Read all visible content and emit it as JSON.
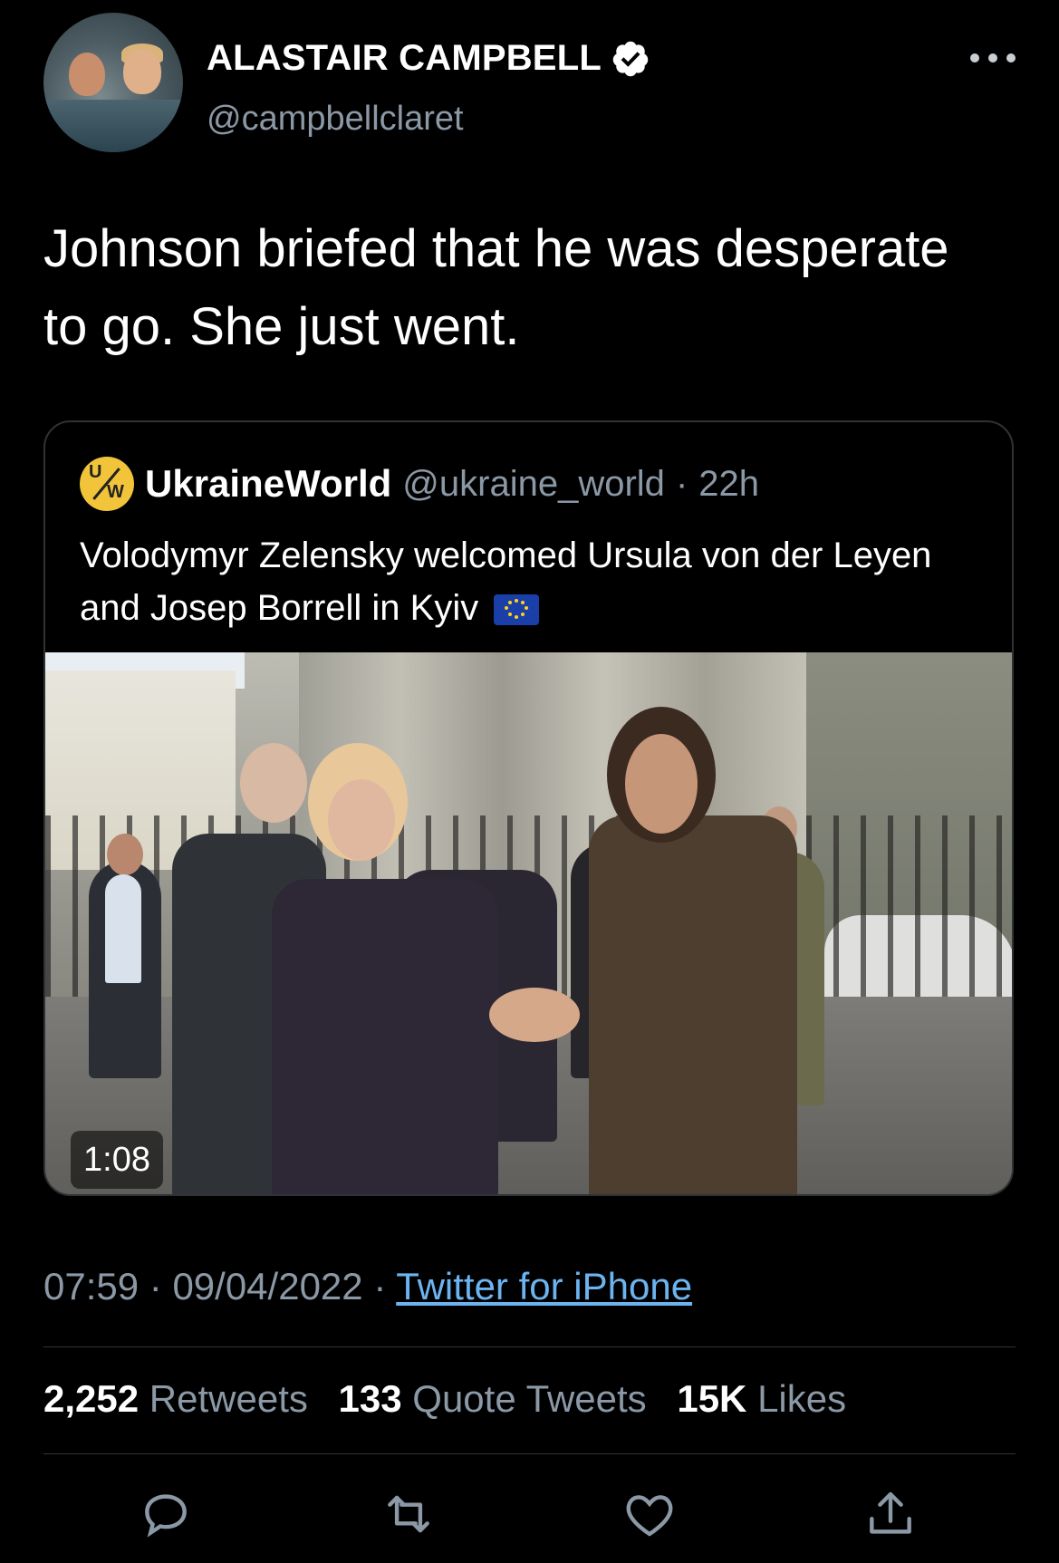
{
  "author": {
    "display_name": "ALASTAIR CAMPBELL",
    "handle": "@campbellclaret",
    "verified": true
  },
  "tweet": {
    "text": "Johnson briefed that he was desperate to go. She just went."
  },
  "quoted_tweet": {
    "author_name": "UkraineWorld",
    "handle": "@ukraine_world",
    "time_ago": "22h",
    "text": "Volodymyr Zelensky welcomed Ursula von der Leyen and Josep Borrell in Kyiv",
    "video_duration": "1:08",
    "avatar_letters": {
      "top": "U",
      "bottom": "W"
    }
  },
  "meta": {
    "time": "07:59",
    "date": "09/04/2022",
    "source": "Twitter for iPhone"
  },
  "stats": {
    "retweets_count": "2,252",
    "retweets_label": "Retweets",
    "quotes_count": "133",
    "quotes_label": "Quote Tweets",
    "likes_count": "15K",
    "likes_label": "Likes"
  },
  "actions": [
    "reply-icon",
    "retweet-icon",
    "like-icon",
    "share-icon"
  ],
  "colors": {
    "background": "#000000",
    "text": "#ffffff",
    "secondary_text": "#8b98a5",
    "link": "#6cb4f0",
    "divider": "#2f3336"
  }
}
